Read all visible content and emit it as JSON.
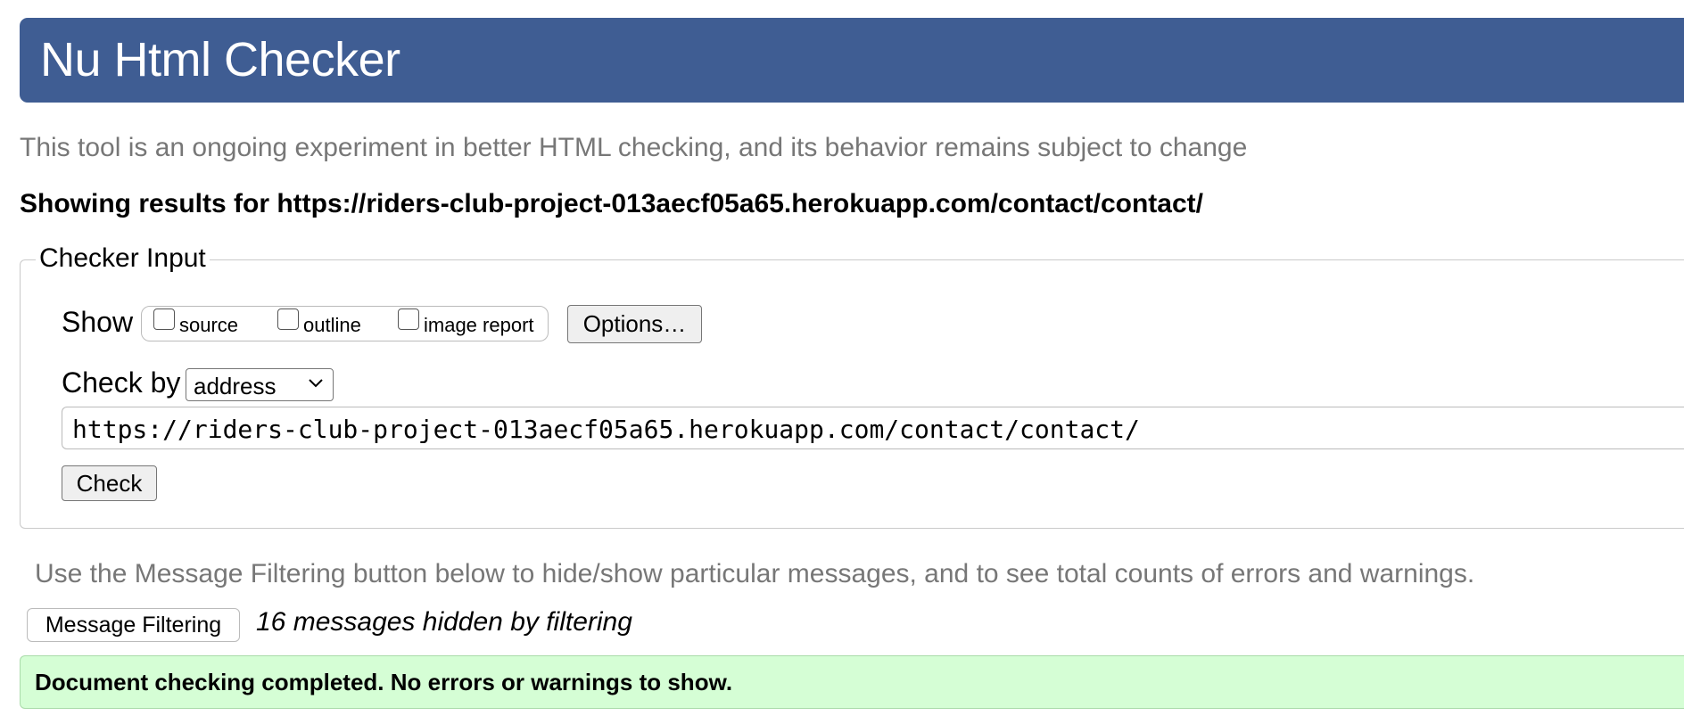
{
  "header": {
    "title": "Nu Html Checker"
  },
  "tagline": "This tool is an ongoing experiment in better HTML checking, and its behavior remains subject to change",
  "results_heading": "Showing results for https://riders-club-project-013aecf05a65.herokuapp.com/contact/contact/",
  "checker_input": {
    "legend": "Checker Input",
    "show_label": "Show",
    "options": [
      {
        "label": "source",
        "checked": false
      },
      {
        "label": "outline",
        "checked": false
      },
      {
        "label": "image report",
        "checked": false
      }
    ],
    "options_button_label": "Options…",
    "check_by_label": "Check by",
    "check_by_value": "address",
    "url_value": "https://riders-club-project-013aecf05a65.herokuapp.com/contact/contact/",
    "check_button_label": "Check"
  },
  "filtering": {
    "note": "Use the Message Filtering button below to hide/show particular messages, and to see total counts of errors and warnings.",
    "button_label": "Message Filtering",
    "hidden_count_text": "16 messages hidden by filtering"
  },
  "result": {
    "message": "Document checking completed. No errors or warnings to show."
  },
  "colors": {
    "header_bg": "#3f5d93",
    "success_bg": "#d5fed5",
    "muted_text": "#777777"
  },
  "icons": {
    "select_arrow": "chevron-down-icon"
  }
}
